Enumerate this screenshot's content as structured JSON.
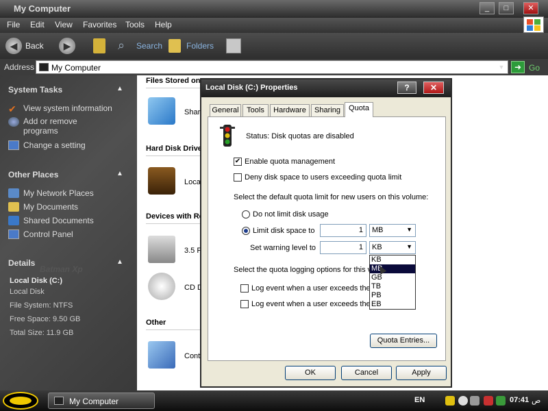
{
  "window": {
    "title": "My Computer",
    "controls": {
      "minimize": "_",
      "maximize": "□",
      "close": "✕"
    }
  },
  "menu": [
    "File",
    "Edit",
    "View",
    "Favorites",
    "Tools",
    "Help"
  ],
  "toolbar": {
    "back": "Back",
    "search": "Search",
    "folders": "Folders"
  },
  "address": {
    "label": "Address",
    "value": "My Computer",
    "go": "Go"
  },
  "left_pane": {
    "system_tasks": {
      "title": "System Tasks",
      "items": [
        "View system information",
        "Add or remove programs",
        "Change a setting"
      ]
    },
    "other_places": {
      "title": "Other Places",
      "items": [
        "My Network Places",
        "My Documents",
        "Shared Documents",
        "Control Panel"
      ]
    },
    "details": {
      "title": "Details",
      "name": "Local Disk (C:)",
      "type": "Local Disk",
      "file_system": "File System: NTFS",
      "free_space": "Free Space: 9.50 GB",
      "total_size": "Total Size: 11.9 GB"
    },
    "watermark": "Batman Xp"
  },
  "content": {
    "groups": [
      {
        "title": "Files Stored on",
        "items": [
          "Shar"
        ]
      },
      {
        "title": "Hard Disk Drive",
        "items": [
          "Loca"
        ]
      },
      {
        "title": "Devices with Re",
        "items": [
          "3.5 F",
          "CD D"
        ]
      },
      {
        "title": "Other",
        "items": [
          "Cont"
        ]
      }
    ]
  },
  "dialog": {
    "title": "Local Disk (C:) Properties",
    "help": "?",
    "close": "✕",
    "tabs": [
      "General",
      "Tools",
      "Hardware",
      "Sharing",
      "Quota"
    ],
    "active_tab": "Quota",
    "status": "Status:  Disk quotas are disabled",
    "enable_quota": {
      "label": "Enable quota management",
      "checked": true
    },
    "deny_space": {
      "label": "Deny disk space to users exceeding quota limit",
      "checked": false
    },
    "default_limit_text": "Select the default quota limit for new users on this volume:",
    "no_limit": {
      "label": "Do not limit disk usage",
      "selected": false
    },
    "limit": {
      "label": "Limit disk space to",
      "selected": true,
      "value": "1",
      "unit": "MB"
    },
    "warning": {
      "label": "Set warning level to",
      "value": "1",
      "unit": "KB"
    },
    "unit_options": [
      "KB",
      "MB",
      "GB",
      "TB",
      "PB",
      "EB"
    ],
    "unit_highlighted": "MB",
    "logging_text": "Select the quota logging options for this vo",
    "log_limit": {
      "label": "Log event when a user exceeds thei",
      "checked": false
    },
    "log_warning": {
      "label": "Log event when a user exceeds thei",
      "checked": false
    },
    "quota_entries": "Quota Entries...",
    "ok": "OK",
    "cancel": "Cancel",
    "apply": "Apply"
  },
  "taskbar": {
    "task": "My Computer",
    "language": "EN",
    "time": "07:41",
    "ampm": "ص"
  },
  "colors": {
    "accent_yellow": "#f0c800",
    "selection": "#0a0a3a",
    "go_green": "#2d9b3a"
  }
}
